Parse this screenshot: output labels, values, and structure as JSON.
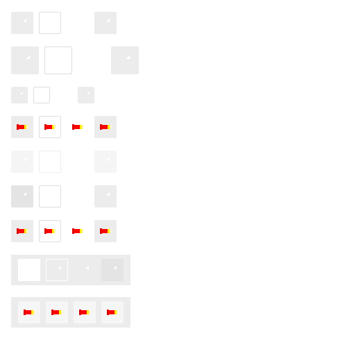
{
  "icons": {
    "refresh": "refresh-icon",
    "rocket": "rocket-icon"
  },
  "colors": {
    "button_fill": "#ececec",
    "button_border": "#dedede",
    "icon_light": "#e0e0e0",
    "rocket_red": "#ff0000",
    "rocket_yellow": "#ffea00",
    "panel_bg": "#ececec"
  },
  "rows": [
    {
      "id": "row-default",
      "variants": [
        "filled",
        "outline",
        "ghost",
        "soft"
      ],
      "icon": "refresh-icon"
    },
    {
      "id": "row-large",
      "variants": [
        "filled",
        "outline",
        "ghost",
        "soft"
      ],
      "icon": "refresh-icon"
    },
    {
      "id": "row-small",
      "variants": [
        "filled",
        "outline",
        "ghost",
        "soft"
      ],
      "icon": "refresh-icon"
    },
    {
      "id": "row-rocket",
      "variants": [
        "filled",
        "outline",
        "ghost",
        "soft"
      ],
      "icon": "rocket-icon"
    },
    {
      "id": "row-disabled",
      "variants": [
        "filled",
        "outline",
        "ghost",
        "soft"
      ],
      "icon": "refresh-icon"
    },
    {
      "id": "row-active",
      "variants": [
        "filled",
        "outline",
        "ghost",
        "soft"
      ],
      "icon": "refresh-icon"
    },
    {
      "id": "row-rocket-2",
      "variants": [
        "filled",
        "outline",
        "ghost",
        "soft"
      ],
      "icon": "rocket-icon"
    },
    {
      "id": "panel-refresh",
      "variants": [
        "filled",
        "outline",
        "ghost",
        "soft"
      ],
      "icon": "refresh-icon"
    },
    {
      "id": "panel-rocket",
      "variants": [
        "filled",
        "outline",
        "ghost",
        "soft"
      ],
      "icon": "rocket-icon"
    }
  ]
}
